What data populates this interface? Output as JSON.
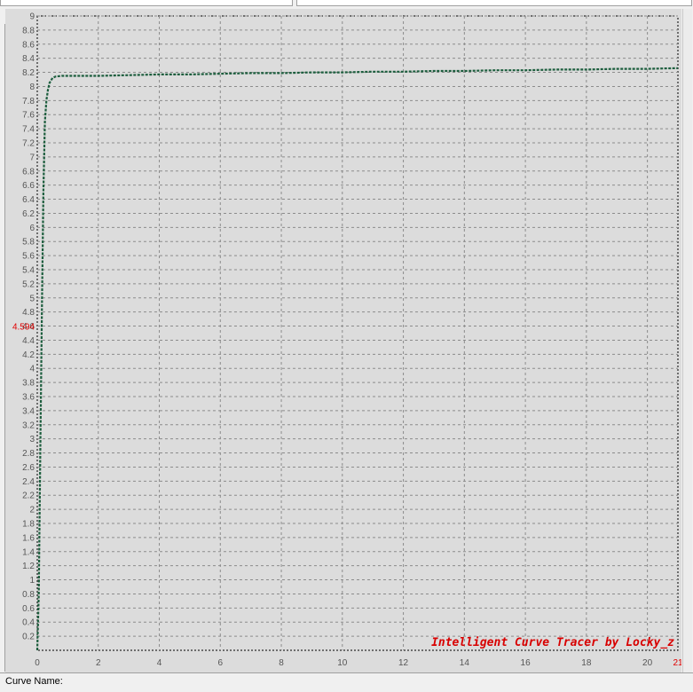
{
  "status_bar": {
    "label": "Curve Name:"
  },
  "colors": {
    "plot_background": "#dcdcdc",
    "grid": "#8c8c8c",
    "curve": "#1d5e3e",
    "marker": "#e00000",
    "watermark": "#d80000"
  },
  "chart_data": {
    "type": "line",
    "title": "",
    "xlabel": "",
    "ylabel": "",
    "xlim": [
      0,
      21
    ],
    "ylim": [
      0,
      9
    ],
    "grid": true,
    "x_ticks": [
      "0",
      "2",
      "4",
      "6",
      "8",
      "10",
      "12",
      "14",
      "16",
      "18",
      "20"
    ],
    "x_end_label": "21",
    "y_ticks": [
      "0.2",
      "0.4",
      "0.6",
      "0.8",
      "1",
      "1.2",
      "1.4",
      "1.6",
      "1.8",
      "2",
      "2.2",
      "2.4",
      "2.6",
      "2.8",
      "3",
      "3.2",
      "3.4",
      "3.6",
      "3.8",
      "4",
      "4.2",
      "4.4",
      "4.6",
      "4.8",
      "5",
      "5.2",
      "5.4",
      "5.6",
      "5.8",
      "6",
      "6.2",
      "6.4",
      "6.6",
      "6.8",
      "7",
      "7.2",
      "7.4",
      "7.6",
      "7.8",
      "8",
      "8.2",
      "8.4",
      "8.6",
      "8.8",
      "9"
    ],
    "y_marker": {
      "value": 4.594,
      "label": "4.594"
    },
    "watermark": "Intelligent Curve Tracer by Locky_z",
    "series": [
      {
        "x": [
          0,
          0.05,
          0.1,
          0.15,
          0.2,
          0.25,
          0.3,
          0.35,
          0.4,
          0.5,
          0.6,
          0.8,
          1,
          2,
          3,
          4,
          5,
          6,
          7,
          8,
          9,
          10,
          11,
          12,
          13,
          14,
          15,
          16,
          17,
          18,
          19,
          20,
          21
        ],
        "y": [
          0,
          0.8,
          2.8,
          4.8,
          6.5,
          7.5,
          7.8,
          7.95,
          8.05,
          8.12,
          8.14,
          8.15,
          8.15,
          8.15,
          8.16,
          8.17,
          8.17,
          8.18,
          8.19,
          8.19,
          8.2,
          8.2,
          8.21,
          8.21,
          8.22,
          8.22,
          8.23,
          8.23,
          8.24,
          8.24,
          8.25,
          8.25,
          8.26
        ]
      }
    ]
  }
}
